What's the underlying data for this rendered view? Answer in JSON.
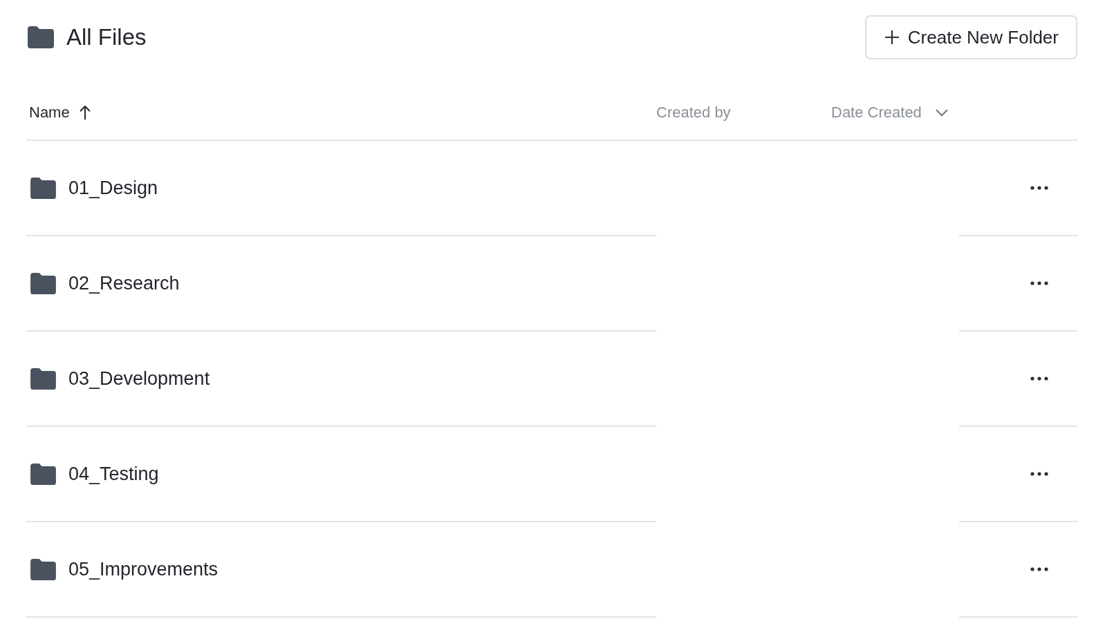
{
  "header": {
    "title": "All Files",
    "button": "Create New Folder"
  },
  "table": {
    "columns": [
      {
        "label": "Name",
        "selected": true,
        "kind": "sort"
      },
      {
        "label": "Created by",
        "selected": false,
        "kind": "plain"
      },
      {
        "label": "Date Created",
        "selected": false,
        "kind": "dropdown"
      }
    ],
    "rows": [
      {
        "name": "01_Design"
      },
      {
        "name": "02_Research"
      },
      {
        "name": "03_Development"
      },
      {
        "name": "04_Testing"
      },
      {
        "name": "05_Improvements"
      }
    ]
  }
}
